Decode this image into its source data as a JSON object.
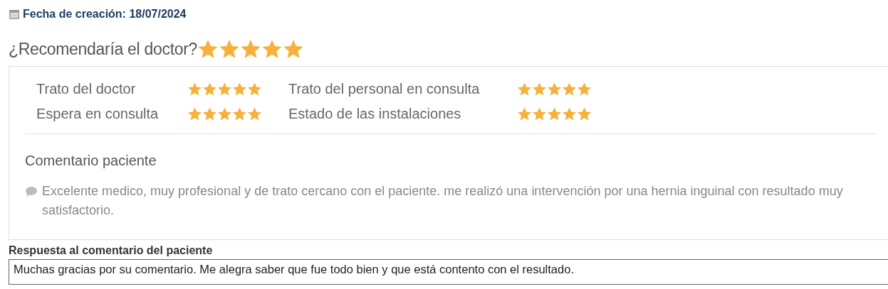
{
  "created": {
    "label": "Fecha de creación: 18/07/2024"
  },
  "recommend": {
    "question": "¿Recomendaría el doctor?",
    "stars": 5
  },
  "ratings": [
    {
      "label": "Trato del doctor",
      "stars": 5
    },
    {
      "label": "Trato del personal en consulta",
      "stars": 5
    },
    {
      "label": "Espera en consulta",
      "stars": 5
    },
    {
      "label": "Estado de las instalaciones",
      "stars": 5
    }
  ],
  "comment": {
    "title": "Comentario paciente",
    "text": "Excelente medico, muy profesional y de trato cercano con el paciente. me realizó una intervención por una hernia inguinal con resultado muy satisfactorio."
  },
  "reply": {
    "label": "Respuesta al comentario del paciente",
    "value": "Muchas gracias por su comentario. Me alegra saber que fue todo bien y que está contento con el resultado."
  }
}
